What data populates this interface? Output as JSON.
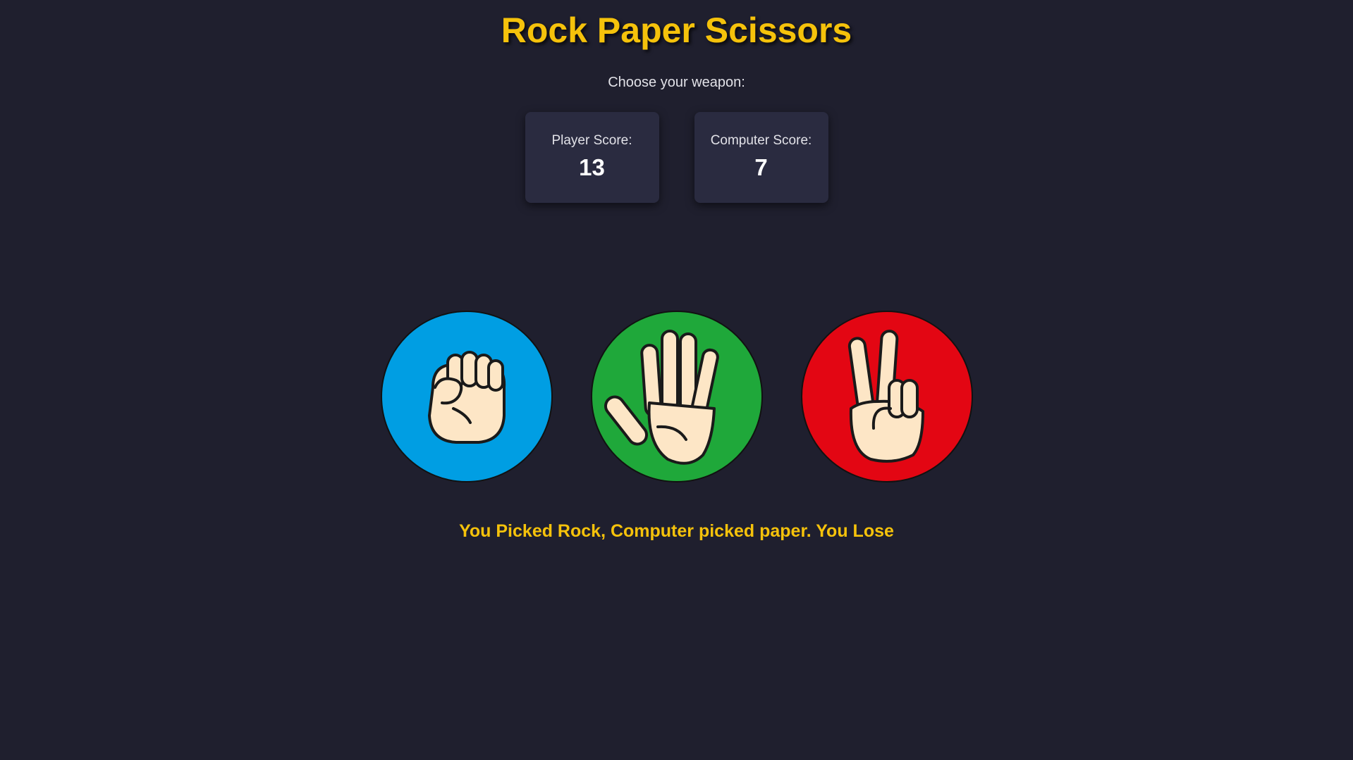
{
  "game": {
    "title": "Rock Paper Scissors",
    "prompt": "Choose your weapon:"
  },
  "scores": {
    "player_label": "Player Score:",
    "player_value": "13",
    "computer_label": "Computer Score:",
    "computer_value": "7"
  },
  "choices": [
    {
      "name": "rock",
      "icon": "fist-icon",
      "color": "#009ee3"
    },
    {
      "name": "paper",
      "icon": "open-hand-icon",
      "color": "#1fa83a"
    },
    {
      "name": "scissors",
      "icon": "peace-hand-icon",
      "color": "#e30613"
    }
  ],
  "result": {
    "message": "You Picked Rock, Computer picked paper. You Lose"
  },
  "colors": {
    "background": "#1f1f2e",
    "accent": "#f5c20b",
    "card": "#2a2b40"
  }
}
